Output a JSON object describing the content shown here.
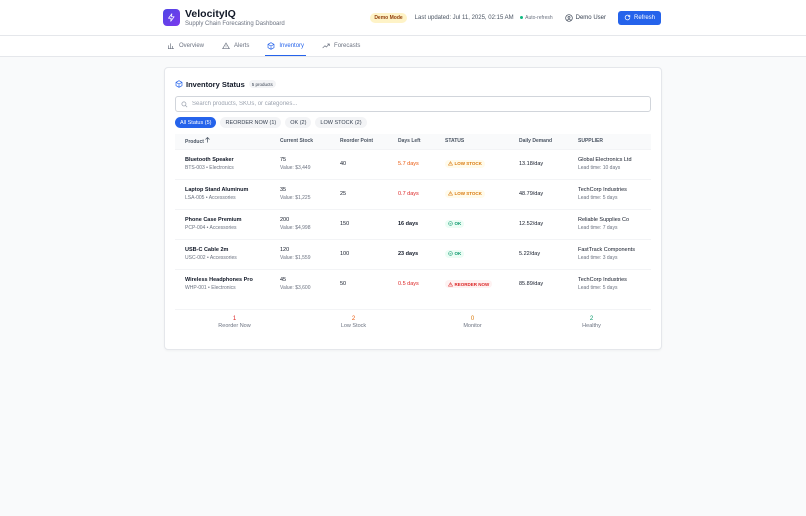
{
  "app": {
    "name": "VelocityIQ",
    "subtitle": "Supply Chain Forecasting Dashboard"
  },
  "header": {
    "demo_badge": "Demo Mode",
    "last_updated": "Last updated: Jul 11, 2025, 02:15 AM",
    "auto_refresh": "Auto-refresh",
    "user": "Demo User",
    "refresh_label": "Refresh"
  },
  "nav": {
    "tabs": [
      {
        "label": "Overview"
      },
      {
        "label": "Alerts"
      },
      {
        "label": "Inventory"
      },
      {
        "label": "Forecasts"
      }
    ],
    "active": "Inventory"
  },
  "inventory": {
    "title": "Inventory Status",
    "count": "5 products",
    "search_placeholder": "Search products, SKUs, or categories...",
    "filters": [
      {
        "label": "All Status (5)"
      },
      {
        "label": "REORDER NOW (1)"
      },
      {
        "label": "OK (2)"
      },
      {
        "label": "LOW STOCK (2)"
      }
    ],
    "columns": {
      "product": "Product",
      "stock": "Current Stock",
      "reorder": "Reorder Point",
      "days": "Days Left",
      "status": "STATUS",
      "demand": "Daily Demand",
      "supplier": "SUPPLIER"
    },
    "rows": [
      {
        "name": "Bluetooth Speaker",
        "meta": "BTS-003 • Electronics",
        "stock": "75",
        "value": "Value: $3,449",
        "reorder": "40",
        "days": "5.7 days",
        "status": "LOW STOCK",
        "demand": "13.18/day",
        "supplier": "Global Electronics Ltd",
        "lead": "Lead time: 10 days"
      },
      {
        "name": "Laptop Stand Aluminum",
        "meta": "LSA-005 • Accessories",
        "stock": "35",
        "value": "Value: $1,225",
        "reorder": "25",
        "days": "0.7 days",
        "status": "LOW STOCK",
        "demand": "48.79/day",
        "supplier": "TechCorp Industries",
        "lead": "Lead time: 5 days"
      },
      {
        "name": "Phone Case Premium",
        "meta": "PCP-004 • Accessories",
        "stock": "200",
        "value": "Value: $4,998",
        "reorder": "150",
        "days": "16 days",
        "status": "OK",
        "demand": "12.52/day",
        "supplier": "Reliable Supplies Co",
        "lead": "Lead time: 7 days"
      },
      {
        "name": "USB-C Cable 2m",
        "meta": "USC-002 • Accessories",
        "stock": "120",
        "value": "Value: $1,559",
        "reorder": "100",
        "days": "23 days",
        "status": "OK",
        "demand": "5.22/day",
        "supplier": "FastTrack Components",
        "lead": "Lead time: 3 days"
      },
      {
        "name": "Wireless Headphones Pro",
        "meta": "WHP-001 • Electronics",
        "stock": "45",
        "value": "Value: $3,600",
        "reorder": "50",
        "days": "0.5 days",
        "status": "REORDER NOW",
        "demand": "85.89/day",
        "supplier": "TechCorp Industries",
        "lead": "Lead time: 5 days"
      }
    ],
    "summary": [
      {
        "value": "1",
        "label": "Reorder Now"
      },
      {
        "value": "2",
        "label": "Low Stock"
      },
      {
        "value": "0",
        "label": "Monitor"
      },
      {
        "value": "2",
        "label": "Healthy"
      }
    ]
  },
  "colors": {
    "primary": "#2563eb",
    "danger": "#dc2626",
    "warning": "#ea580c",
    "success": "#059669",
    "brand": "#4f46e5"
  }
}
